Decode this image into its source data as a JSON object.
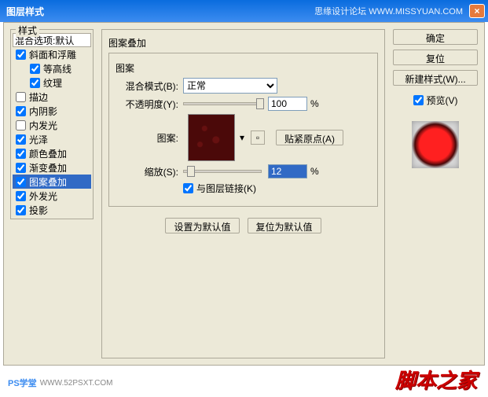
{
  "titlebar": {
    "title": "图层样式",
    "meta": "思缘设计论坛  WWW.MISSYUAN.COM",
    "close": "×"
  },
  "styles": {
    "legend": "样式",
    "blend_label": "混合选项:默认",
    "items": [
      {
        "label": "斜面和浮雕",
        "checked": true
      },
      {
        "label": "等高线",
        "checked": true,
        "indent": true
      },
      {
        "label": "纹理",
        "checked": true,
        "indent": true
      },
      {
        "label": "描边",
        "checked": false
      },
      {
        "label": "内阴影",
        "checked": true
      },
      {
        "label": "内发光",
        "checked": false
      },
      {
        "label": "光泽",
        "checked": true
      },
      {
        "label": "颜色叠加",
        "checked": true
      },
      {
        "label": "渐变叠加",
        "checked": true
      },
      {
        "label": "图案叠加",
        "checked": true,
        "selected": true
      },
      {
        "label": "外发光",
        "checked": true
      },
      {
        "label": "投影",
        "checked": true
      }
    ]
  },
  "main": {
    "legend": "图案叠加",
    "pattern_legend": "图案",
    "blend_mode_label": "混合模式(B):",
    "blend_mode_value": "正常",
    "opacity_label": "不透明度(Y):",
    "opacity_value": "100",
    "opacity_pct": "%",
    "pattern_label": "图案:",
    "snap_btn": "贴紧原点(A)",
    "scale_label": "缩放(S):",
    "scale_value": "12",
    "scale_pct": "%",
    "link_label": "与图层链接(K)",
    "set_default_btn": "设置为默认值",
    "reset_default_btn": "复位为默认值"
  },
  "right": {
    "ok": "确定",
    "reset": "复位",
    "new_style": "新建样式(W)...",
    "preview_label": "预览(V)"
  },
  "footer": {
    "ps": "PS学堂",
    "url": "WWW.52PSXT.COM",
    "logo": "脚本之家"
  }
}
